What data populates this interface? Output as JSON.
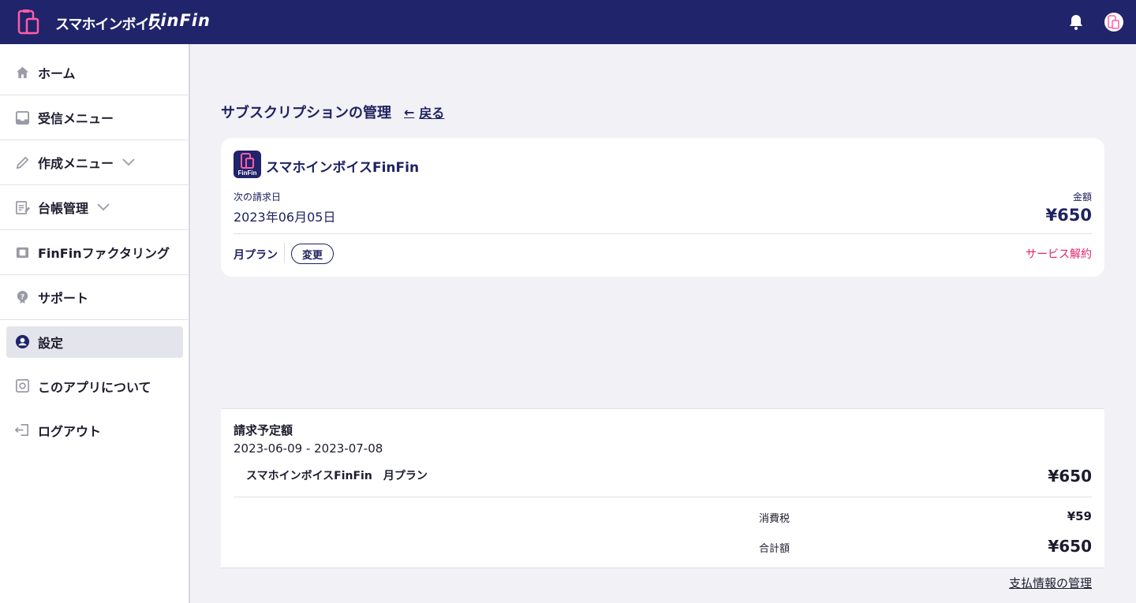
{
  "header": {
    "brand_name": "スマホインボイス",
    "brand_logo": "FinFin",
    "notification_icon": "bell-icon",
    "avatar_icon": "user-avatar-icon"
  },
  "sidebar": {
    "items": [
      {
        "label": "ホーム",
        "icon": "home-icon"
      },
      {
        "label": "受信メニュー",
        "icon": "inbox-icon"
      },
      {
        "label": "作成メニュー",
        "icon": "pencil-icon"
      },
      {
        "label": "台帳管理",
        "icon": "ledger-icon"
      },
      {
        "label": "FinFinファクタリング",
        "icon": "wallet-icon"
      },
      {
        "label": "サポート",
        "icon": "help-icon"
      },
      {
        "label": "設定",
        "icon": "account-icon"
      },
      {
        "label": "このアプリについて",
        "icon": "app-info-icon"
      },
      {
        "label": "ログアウト",
        "icon": "logout-icon"
      }
    ],
    "active": "設定"
  },
  "page": {
    "title": "サブスクリプションの管理",
    "back_label": "戻る"
  },
  "subscription": {
    "app_name": "スマホインボイスFinFin",
    "next_billing_label": "次の請求日",
    "next_billing_date": "2023年06月05日",
    "amount_label": "金額",
    "amount": "¥650",
    "plan_label": "月プラン",
    "change_label": "変更",
    "cancel_label": "サービス解約"
  },
  "billing": {
    "title": "請求予定額",
    "period": "2023-06-09 - 2023-07-08",
    "item_label": "スマホインボイスFinFin　月プラン",
    "item_amount": "¥650",
    "tax_label": "消費税",
    "tax_amount": "¥59",
    "total_label": "合計額",
    "total_amount": "¥650",
    "payment_link": "支払情報の管理"
  },
  "colors": {
    "header_bg": "#20246a",
    "accent_pink": "#e0256b",
    "text_navy": "#1f2260"
  }
}
